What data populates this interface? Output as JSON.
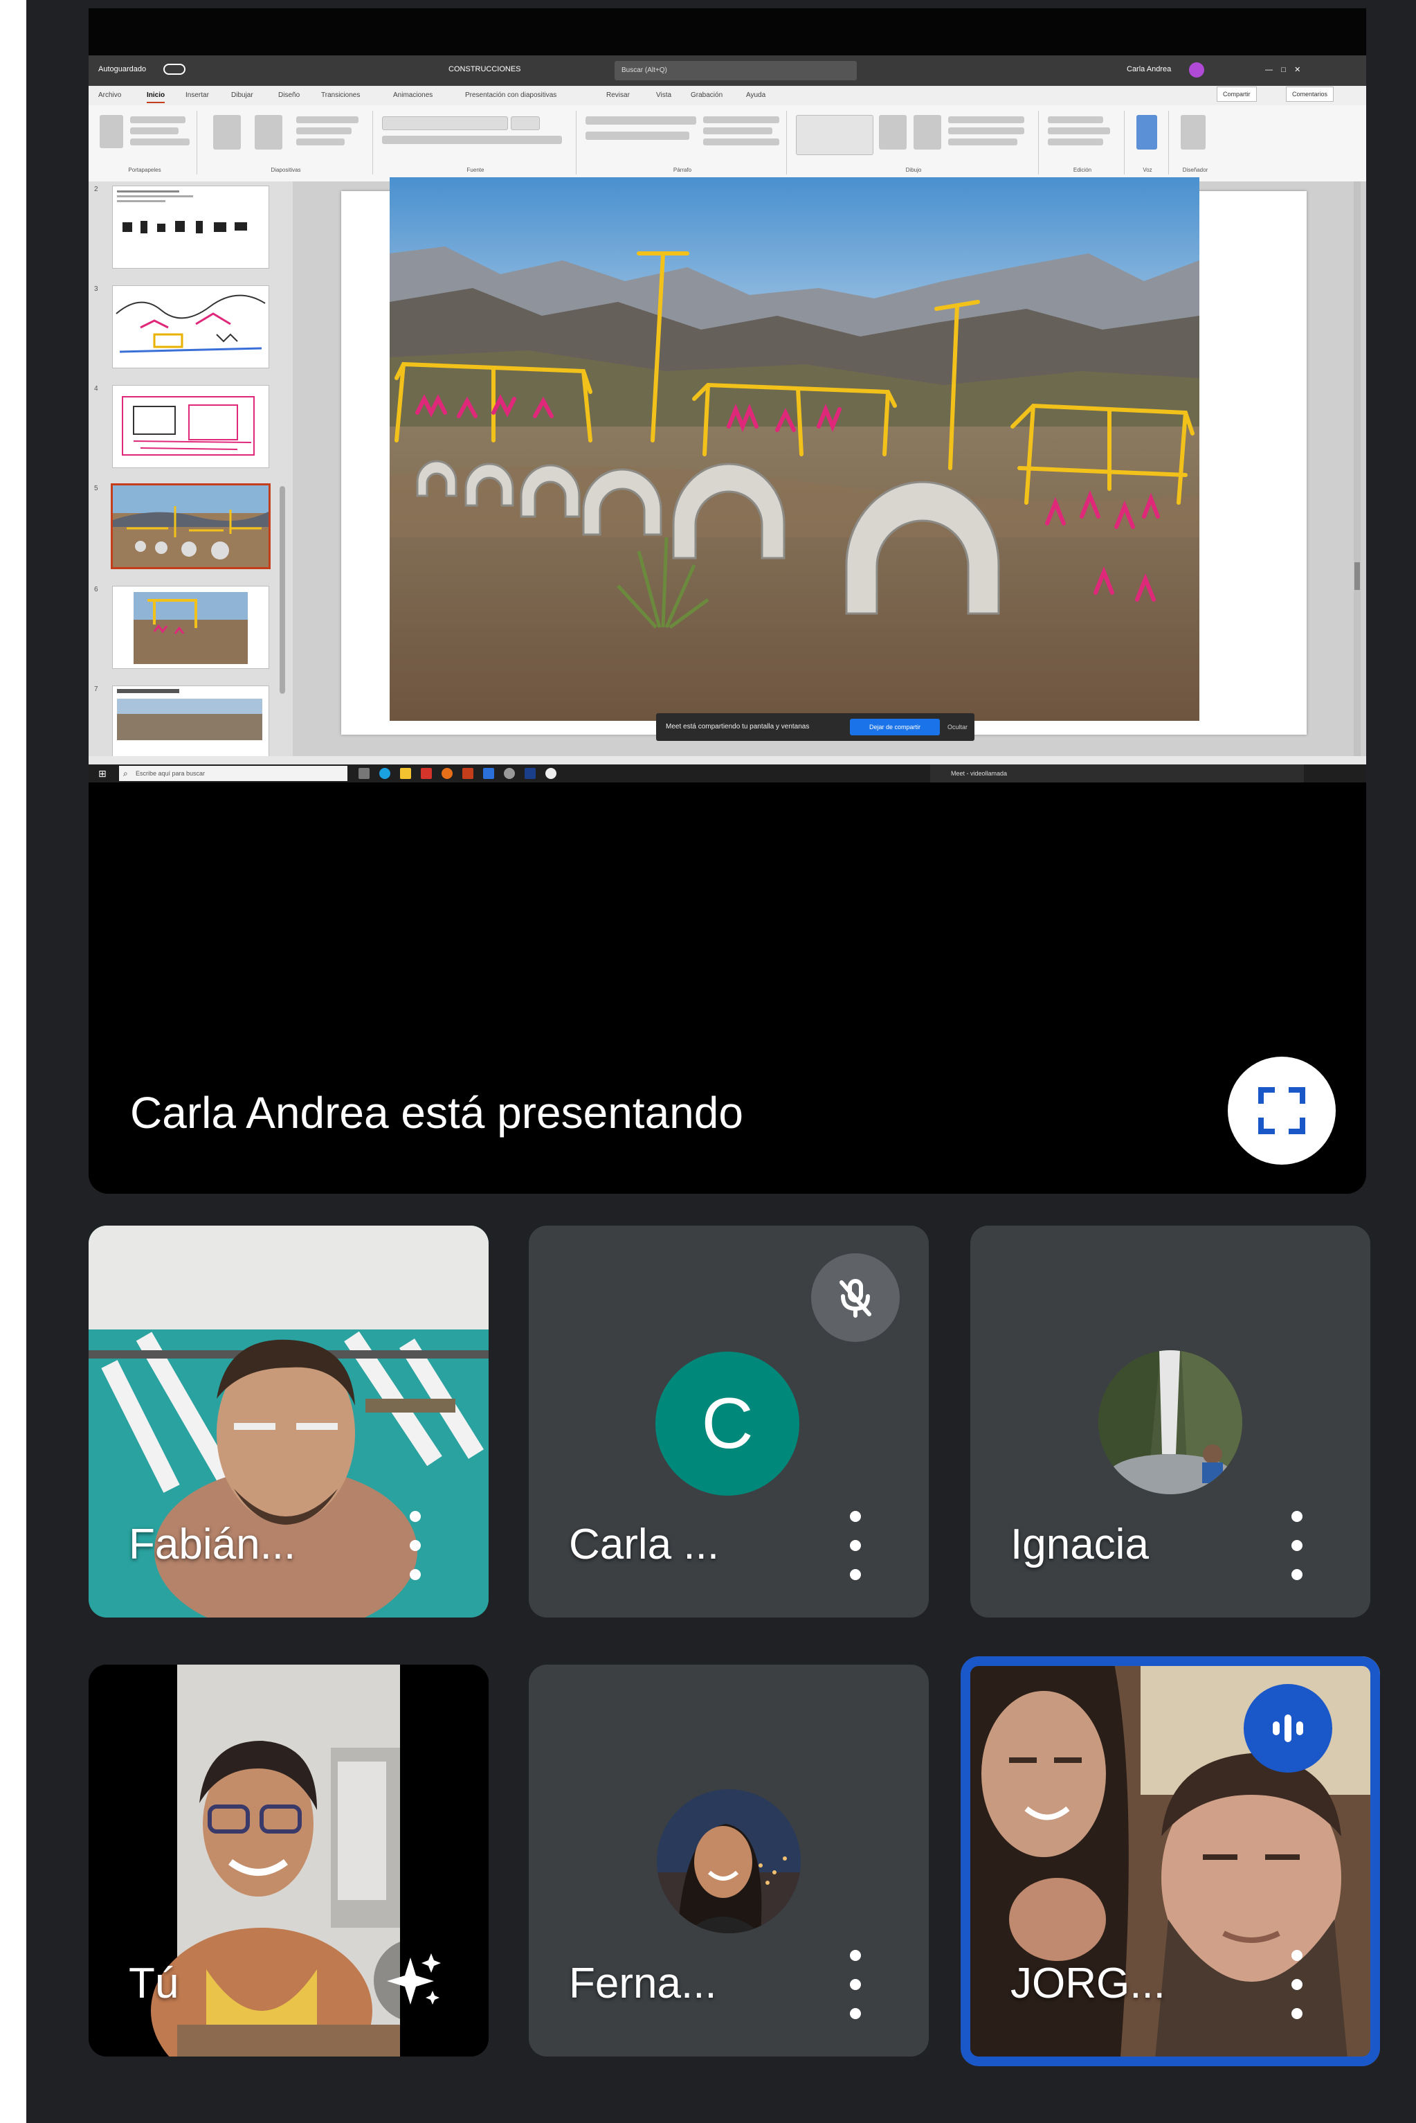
{
  "presentation": {
    "banner_text": "Carla Andrea está presentando",
    "fullscreen_icon": "fullscreen-icon",
    "shared_screen": {
      "title_left": "Autoguardado",
      "document_title": "CONSTRUCCIONES",
      "search_placeholder": "Buscar (Alt+Q)",
      "user_name": "Carla Andrea",
      "ribbon_tabs": [
        "Archivo",
        "Inicio",
        "Insertar",
        "Dibujar",
        "Diseño",
        "Transiciones",
        "Animaciones",
        "Presentación con diapositivas",
        "Revisar",
        "Vista",
        "Grabación",
        "Ayuda"
      ],
      "ribbon_groups": [
        "Portapapeles",
        "Diapositivas",
        "Fuente",
        "Párrafo",
        "Dibujo",
        "Edición",
        "Voz",
        "Diseñador"
      ],
      "share_label": "Compartir",
      "comments_label": "Comentarios",
      "notification_text": "Meet está compartiendo tu pantalla y ventanas",
      "notification_button": "Dejar de compartir",
      "notification_close": "Ocultar",
      "taskbar_search": "Escribe aquí para buscar",
      "taskbar_popup": "Meet - videollamada"
    }
  },
  "participants": [
    {
      "name": "Fabián...",
      "type": "video"
    },
    {
      "name": "Carla ...",
      "type": "avatar",
      "initial": "C",
      "muted": true,
      "avatar_color": "#00897b"
    },
    {
      "name": "Ignacia",
      "type": "photo"
    },
    {
      "name": "Tú",
      "type": "video",
      "effects": true
    },
    {
      "name": "Ferna...",
      "type": "photo"
    },
    {
      "name": "JORG...",
      "type": "video",
      "speaking": true
    }
  ],
  "colors": {
    "background": "#202124",
    "tile": "#3c4043",
    "speaking_accent": "#1a57c8",
    "muted_badge": "#5f6368"
  }
}
